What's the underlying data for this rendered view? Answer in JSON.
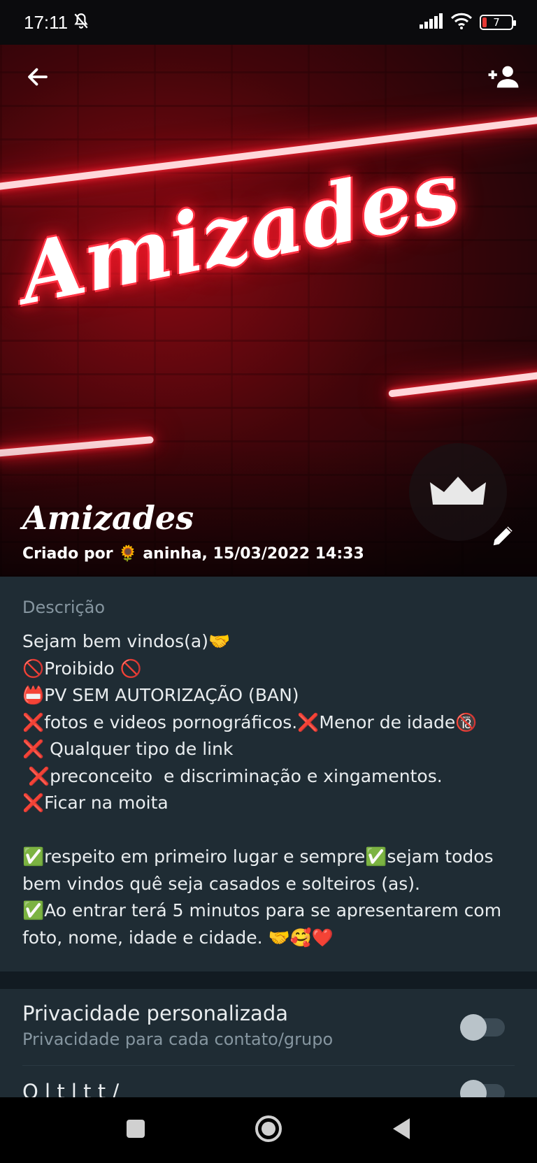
{
  "status_bar": {
    "time": "17:11",
    "battery_level": "7",
    "icons": [
      "mute-bell-icon",
      "signal-icon",
      "wifi-icon",
      "battery-icon"
    ]
  },
  "header": {
    "back_icon": "arrow-left-icon",
    "add_icon": "add-person-icon",
    "banner_text": "Amizades",
    "group_name": "Amizades",
    "created_by": "Criado por 🌻 aninha, 15/03/2022 14:33",
    "admin_icon": "crown-icon",
    "edit_icon": "pencil-icon"
  },
  "description": {
    "label": "Descrição",
    "lines": [
      "Sejam bem vindos(a)🤝",
      "🚫Proibido 🚫",
      "📛PV SEM AUTORIZAÇÃO (BAN)",
      "❌fotos e videos pornográficos.❌Menor de idade🔞",
      "❌ Qualquer tipo de link",
      " ❌preconceito  e discriminação e xingamentos.",
      "❌Ficar na moita",
      "",
      "✅respeito em primeiro lugar e sempre✅sejam todos",
      "bem vindos quê seja casados e solteiros (as).",
      "✅Ao entrar terá 5 minutos para se apresentarem com",
      "foto, nome, idade e cidade. 🤝🥰❤️"
    ]
  },
  "settings": {
    "custom_privacy_title": "Privacidade personalizada",
    "custom_privacy_sub": "Privacidade para cada contato/grupo",
    "custom_privacy_on": false,
    "second_title_partial": "Q    l t               l         t t /",
    "second_on": false
  },
  "colors": {
    "panel": "#1f2c34",
    "background": "#121b22",
    "secondary_text": "#8696a0",
    "neon_red": "#ff1a2a"
  },
  "nav": {
    "recents_icon": "square-icon",
    "home_icon": "circle-home-icon",
    "back_icon": "triangle-back-icon"
  }
}
